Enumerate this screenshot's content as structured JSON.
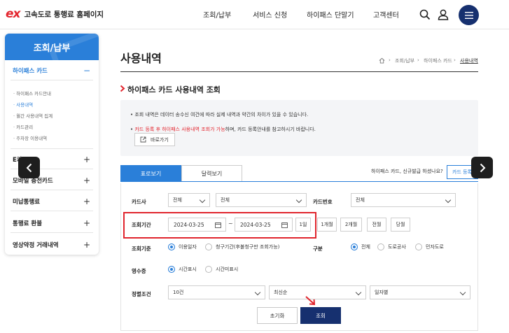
{
  "header": {
    "logo_mark": "ex",
    "site_title": "고속도로 통행료 홈페이지",
    "nav": [
      "조회/납부",
      "서비스 신청",
      "하이패스 단말기",
      "고객센터"
    ]
  },
  "sidebar": {
    "title": "조회/납부",
    "sections": [
      {
        "label": "하이패스 카드",
        "sign": "−"
      },
      {
        "label": "E카드",
        "sign": "+"
      },
      {
        "label": "모바일 충전카드",
        "sign": "+"
      },
      {
        "label": "미납통행료",
        "sign": "+"
      },
      {
        "label": "통행료 환불",
        "sign": "+"
      },
      {
        "label": "영상약정 거래내역",
        "sign": "+"
      }
    ],
    "sub_items": [
      "· 하이패스 카드안내",
      "· 사용내역",
      "· 월간 사용내역 집계",
      "· 카드관리",
      "· 주차장 이용내역"
    ]
  },
  "main": {
    "page_title": "사용내역",
    "breadcrumb": [
      "조회/납부",
      "하이패스 카드",
      "사용내역"
    ],
    "section_title": "하이패스 카드 사용내역 조회",
    "notice": {
      "line1": "조회 내역은 데이터 송수신 여건에 따라 실제 내역과 약간의 차이가 있을 수 있습니다.",
      "line2_red": "카드 등록 후 하이패스 사용내역 조회가 가능",
      "line2_rest": "하며, 카드 등록안내를 참고하시기 바랍니다.",
      "goto_label": "바로가기"
    },
    "tabs": [
      "표로보기",
      "달력보기"
    ],
    "info_text": "하이패스 카드, 신규발급 하셨나요?",
    "register_label": "카드 등록",
    "form": {
      "card_company_label": "카드사",
      "card_company_value": "전체",
      "card_type_value": "전체",
      "card_number_label": "카드번호",
      "card_number_value": "전체",
      "period_label": "조회기간",
      "date_from": "2024-03-25",
      "date_to": "2024-03-25",
      "tilde": "~",
      "period_buttons": [
        "1일",
        "1개월",
        "2개월",
        "전월",
        "당월"
      ],
      "criteria_label": "조회기준",
      "criteria_options": [
        "이용일자",
        "청구기간(후불청구만 조회가능)"
      ],
      "category_label": "구분",
      "category_options": [
        "전체",
        "도로공사",
        "민자도로"
      ],
      "receipt_label": "영수증",
      "receipt_options": [
        "시간표시",
        "시간미표시"
      ],
      "sort_label": "정렬조건",
      "sort_values": [
        "10건",
        "최신순",
        "일자별"
      ],
      "reset_label": "초기화",
      "search_label": "조회"
    }
  },
  "colors": {
    "brand_navy": "#16306f",
    "accent_blue": "#2a7fd9",
    "highlight_red": "#e0252d"
  }
}
